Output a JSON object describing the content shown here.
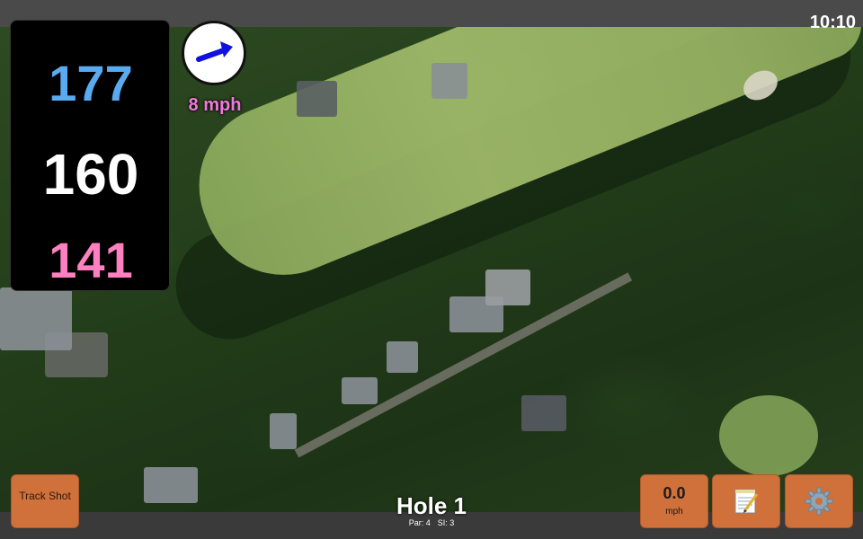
{
  "status": {
    "time": "10:10"
  },
  "yardage": {
    "back": "177",
    "middle": "160",
    "front": "141",
    "colors": {
      "back": "#5aaaf0",
      "middle": "#ffffff",
      "front": "#ff80c0"
    }
  },
  "wind": {
    "speed": "8 mph",
    "icon": "arrow-icon",
    "color": "#f07adc"
  },
  "hole": {
    "title": "Hole 1",
    "par": "Par: 4",
    "si": "SI: 3"
  },
  "buttons": {
    "track_shot": "Track Shot",
    "speed_value": "0.0",
    "speed_unit": "mph",
    "notes_icon": "notepad-icon",
    "settings_icon": "gear-icon",
    "accent": "#d0703a"
  }
}
